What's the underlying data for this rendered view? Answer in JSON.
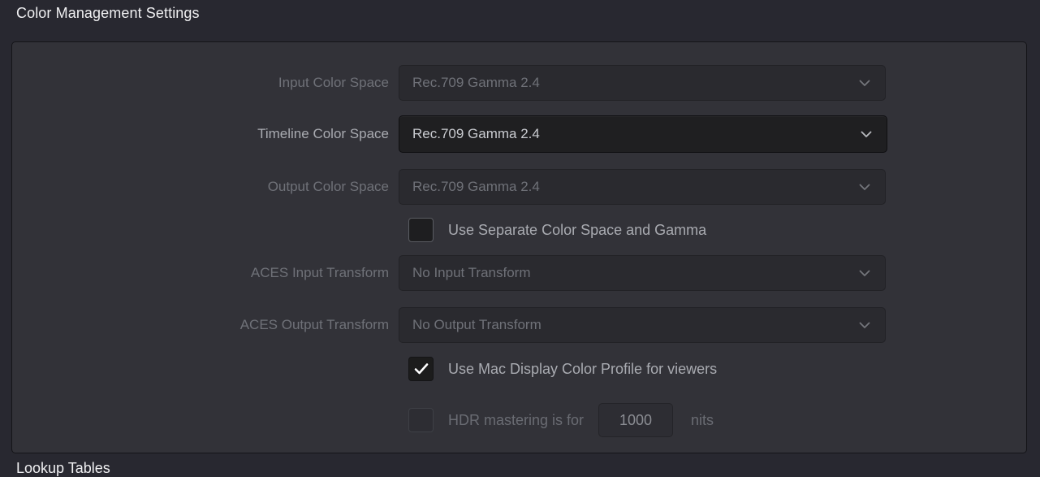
{
  "section": {
    "title": "Color Management Settings"
  },
  "next_section": {
    "title": "Lookup Tables"
  },
  "fields": [
    {
      "label": "Input Color Space",
      "value": "Rec.709 Gamma 2.4",
      "state": "disabled",
      "icon": "chevron-down-icon"
    },
    {
      "label": "Timeline Color Space",
      "value": "Rec.709 Gamma 2.4",
      "state": "active",
      "icon": "chevron-down-icon"
    },
    {
      "label": "Output Color Space",
      "value": "Rec.709 Gamma 2.4",
      "state": "disabled",
      "icon": "chevron-down-icon"
    },
    {
      "label": "ACES Input Transform",
      "value": "No Input Transform",
      "state": "disabled",
      "icon": "chevron-down-icon"
    },
    {
      "label": "ACES Output Transform",
      "value": "No Output Transform",
      "state": "disabled",
      "icon": "chevron-down-icon"
    }
  ],
  "checkboxes": {
    "separate_color_space": {
      "label": "Use Separate Color Space and Gamma",
      "checked": false,
      "state": "enabled"
    },
    "mac_display_profile": {
      "label": "Use Mac Display Color Profile for viewers",
      "checked": true,
      "state": "enabled"
    },
    "hdr_mastering": {
      "label": "HDR mastering is for",
      "checked": false,
      "state": "disabled",
      "nits_value": "1000",
      "unit_label": "nits"
    }
  },
  "colors": {
    "window_background": "#282830",
    "panel_background": "#323238",
    "panel_border": "#141418",
    "label_enabled": "#a9abb1",
    "label_disabled": "#6f7178",
    "dropdown_disabled_bg": "#2a2a2f",
    "dropdown_active_bg": "#1f1f21",
    "title_text": "#f0f0f2",
    "checkmark": "#ffffff"
  }
}
